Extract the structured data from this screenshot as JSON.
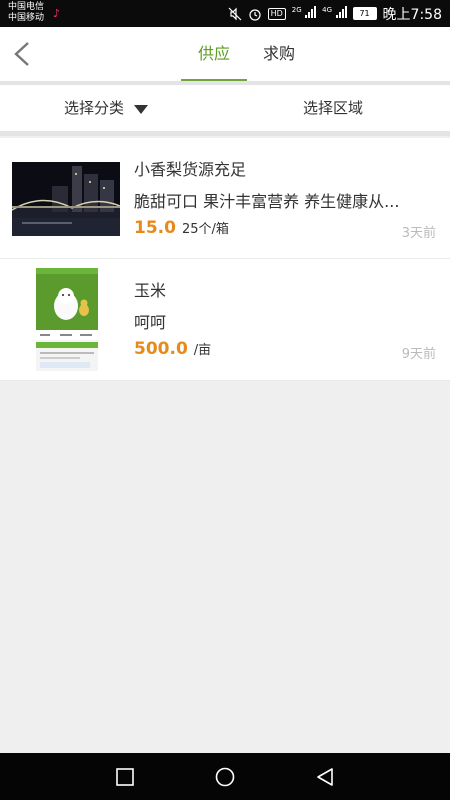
{
  "status_bar": {
    "carrier1": "中国电信",
    "carrier2": "中国移动",
    "hd_badge": "HD",
    "net1": "2G",
    "net2": "4G",
    "battery": "71",
    "time": "晚上7:58"
  },
  "header": {
    "back_icon": "chevron-left-icon",
    "tabs": [
      {
        "label": "供应",
        "active": true
      },
      {
        "label": "求购",
        "active": false
      }
    ],
    "accent": "#6fa53a"
  },
  "filters": {
    "category": "选择分类",
    "region": "选择区域"
  },
  "listings": [
    {
      "title": "小香梨货源充足",
      "desc": "脆甜可口 果汁丰富营养 养生健康从...",
      "price": "15.0",
      "unit": "25个/箱",
      "time": "3天前"
    },
    {
      "title": "玉米",
      "desc": "呵呵",
      "price": "500.0",
      "unit": "/亩",
      "time": "9天前"
    }
  ],
  "colors": {
    "price": "#e88a1a",
    "time": "#bbbbbb",
    "background": "#efefef"
  },
  "nav": [
    "recent-apps-icon",
    "home-icon",
    "back-icon"
  ]
}
